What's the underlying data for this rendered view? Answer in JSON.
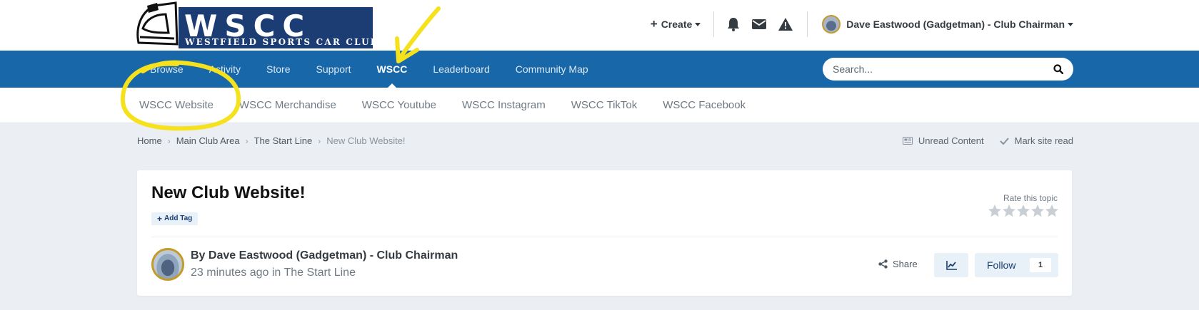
{
  "logo": {
    "main": "WSCC",
    "sub": "WESTFIELD SPORTS CAR CLUB"
  },
  "header": {
    "create_label": "Create",
    "user_name": "Dave Eastwood (Gadgetman) - Club Chairman",
    "icons": [
      "bell-icon",
      "envelope-icon",
      "warning-icon"
    ]
  },
  "nav": {
    "items": [
      {
        "label": "Browse"
      },
      {
        "label": "Activity"
      },
      {
        "label": "Store"
      },
      {
        "label": "Support"
      },
      {
        "label": "WSCC",
        "active": true
      },
      {
        "label": "Leaderboard"
      },
      {
        "label": "Community Map"
      }
    ],
    "search_placeholder": "Search..."
  },
  "subnav": {
    "items": [
      {
        "label": "WSCC Website"
      },
      {
        "label": "WSCC Merchandise"
      },
      {
        "label": "WSCC Youtube"
      },
      {
        "label": "WSCC Instagram"
      },
      {
        "label": "WSCC TikTok"
      },
      {
        "label": "WSCC Facebook"
      }
    ]
  },
  "breadcrumb": {
    "items": [
      "Home",
      "Main Club Area",
      "The Start Line",
      "New Club Website!"
    ],
    "unread_label": "Unread Content",
    "mark_read_label": "Mark site read"
  },
  "topic": {
    "title": "New Club Website!",
    "add_tag_label": "Add Tag",
    "rate_label": "Rate this topic",
    "rating_stars": 5,
    "rating_value": 0,
    "author_prefix": "By",
    "author_name": "Dave Eastwood (Gadgetman) - Club Chairman",
    "time_ago": "23 minutes ago",
    "in_word": "in",
    "forum": "The Start Line",
    "share_label": "Share",
    "follow_label": "Follow",
    "follow_count": "1"
  },
  "colors": {
    "nav_blue": "#1867a8",
    "logo_navy": "#1b3d73",
    "annotation_yellow": "#f5e11c",
    "page_bg": "#ebeef2"
  }
}
